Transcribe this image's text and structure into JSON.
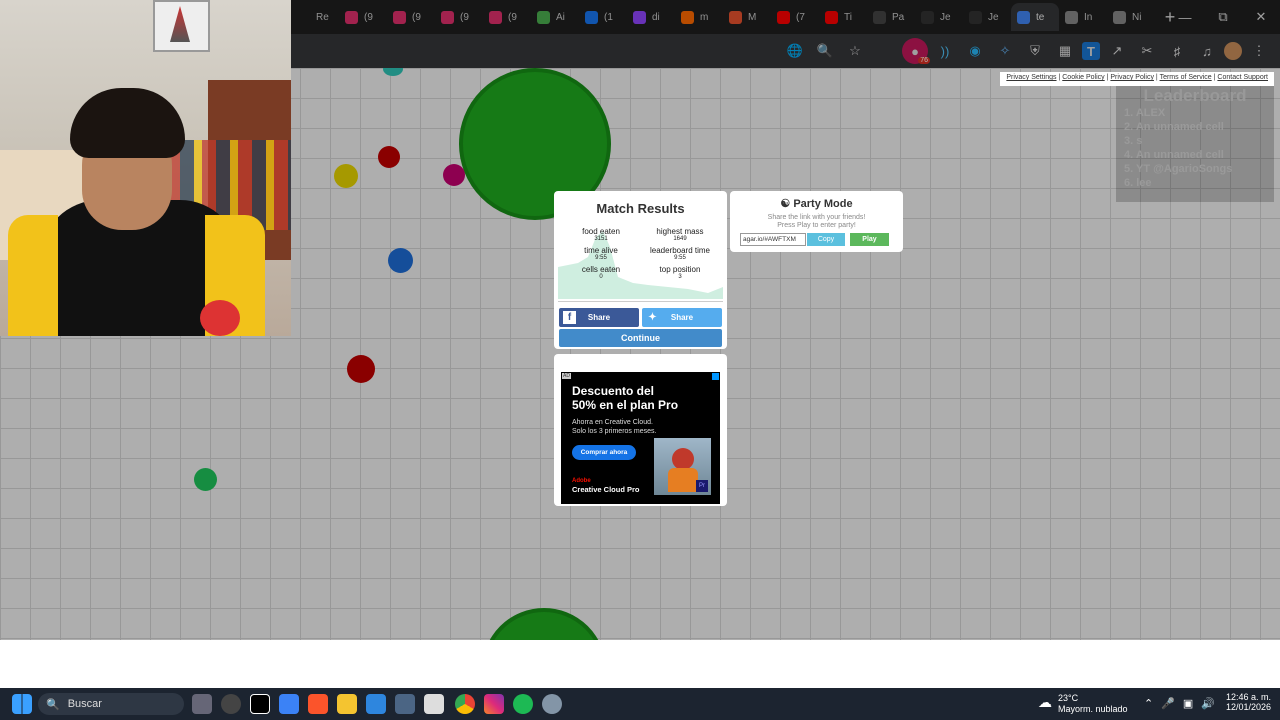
{
  "browser": {
    "tabs": [
      {
        "label": "Re",
        "color": "#1f1f1f"
      },
      {
        "label": "(9",
        "color": "#e1306c"
      },
      {
        "label": "(9",
        "color": "#e1306c"
      },
      {
        "label": "(9",
        "color": "#e1306c"
      },
      {
        "label": "(9",
        "color": "#e1306c"
      },
      {
        "label": "Ai",
        "color": "#4caf50"
      },
      {
        "label": "(1",
        "color": "#1877f2"
      },
      {
        "label": "di",
        "color": "#9146ff"
      },
      {
        "label": "m",
        "color": "#ff6a00"
      },
      {
        "label": "M",
        "color": "#e8532e"
      },
      {
        "label": "(7",
        "color": "#ff0000"
      },
      {
        "label": "Ti",
        "color": "#ff0000"
      },
      {
        "label": "Pa",
        "color": "#444444"
      },
      {
        "label": "Je",
        "color": "#333333"
      },
      {
        "label": "Je",
        "color": "#333333"
      },
      {
        "label": "te",
        "color": "#4285f4"
      },
      {
        "label": "In",
        "color": "#888888"
      },
      {
        "label": "Ni",
        "color": "#888888"
      }
    ],
    "new_tab": "+",
    "extension_badge": "76"
  },
  "legal_links": [
    "Privacy Settings",
    "Cookie Policy",
    "Privacy Policy",
    "Terms of Service",
    "Contact Support"
  ],
  "leaderboard": {
    "title": "Leaderboard",
    "entries": [
      "1. ALEX",
      "2. An unnamed cell",
      "3. s",
      "4. An unnamed cell",
      "5. YT @AgarioSongs",
      "6. lee"
    ]
  },
  "match_results": {
    "title": "Match Results",
    "stats": [
      {
        "label": "food eaten",
        "value": "3151"
      },
      {
        "label": "highest mass",
        "value": "1649"
      },
      {
        "label": "time alive",
        "value": "9:55"
      },
      {
        "label": "leaderboard time",
        "value": "9:55"
      },
      {
        "label": "cells eaten",
        "value": "0"
      },
      {
        "label": "top position",
        "value": "3"
      }
    ],
    "share_facebook": "Share",
    "share_twitter": "Share",
    "continue": "Continue"
  },
  "party_mode": {
    "title": "Party Mode",
    "line1": "Share the link with your friends!",
    "line2": "Press Play to enter party!",
    "link": "agar.io/#AWFTXM",
    "copy": "Copy",
    "play": "Play"
  },
  "ad": {
    "tag": "AD",
    "headline1": "Descuento del",
    "headline2": "50% en el plan Pro",
    "body1": "Ahorra en Creative Cloud.",
    "body2": "Solo los 3 primeros meses.",
    "button": "Comprar ahora",
    "brand": "Adobe",
    "product": "Creative Cloud Pro"
  },
  "taskbar": {
    "search": "Buscar",
    "weather_temp": "23°C",
    "weather_desc": "Mayorm. nublado",
    "time": "12:46 a. m.",
    "date": "12/01/2026"
  },
  "colors": {
    "player_cell": "#1fa91f",
    "continue": "#428bca",
    "facebook": "#3b5998",
    "twitter": "#55acee",
    "play": "#5cb85c",
    "copy": "#5bc0de"
  }
}
